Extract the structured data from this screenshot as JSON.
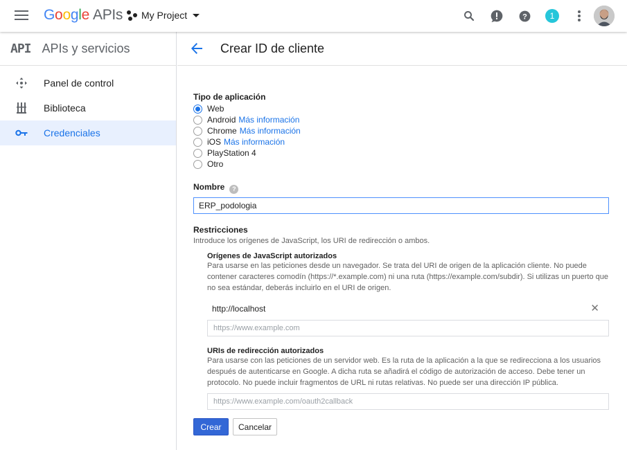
{
  "topbar": {
    "logo_google": [
      "G",
      "o",
      "o",
      "g",
      "l",
      "e"
    ],
    "logo_apis": "APIs",
    "project_name": "My Project",
    "notification_count": "1",
    "icons": [
      "menu-icon",
      "search-icon",
      "alert-icon",
      "help-icon",
      "more-vert-icon"
    ]
  },
  "sidebar": {
    "api_mark": "API",
    "title": "APIs y servicios",
    "items": [
      {
        "label": "Panel de control",
        "icon": "dashboard-icon"
      },
      {
        "label": "Biblioteca",
        "icon": "library-icon"
      },
      {
        "label": "Credenciales",
        "icon": "key-icon",
        "active": true
      }
    ]
  },
  "main": {
    "title": "Crear ID de cliente",
    "app_type": {
      "label": "Tipo de aplicación",
      "options": [
        {
          "label": "Web",
          "checked": true
        },
        {
          "label": "Android",
          "link": "Más información"
        },
        {
          "label": "Chrome",
          "link": "Más información"
        },
        {
          "label": "iOS",
          "link": "Más información"
        },
        {
          "label": "PlayStation 4"
        },
        {
          "label": "Otro"
        }
      ]
    },
    "name": {
      "label": "Nombre",
      "help": "?",
      "value": "ERP_podologia"
    },
    "restrictions": {
      "label": "Restricciones",
      "description": "Introduce los orígenes de JavaScript, los URI de redirección o ambos.",
      "js_origins": {
        "title": "Orígenes de JavaScript autorizados",
        "description": "Para usarse en las peticiones desde un navegador. Se trata del URI de origen de la aplicación cliente. No puede contener caracteres comodín (https://*.example.com) ni una ruta (https://example.com/subdir). Si utilizas un puerto que no sea estándar, deberás incluirlo en el URI de origen.",
        "entries": [
          "http://localhost"
        ],
        "placeholder": "https://www.example.com"
      },
      "redirect_uris": {
        "title": "URIs de redirección autorizados",
        "description": "Para usarse con las peticiones de un servidor web. Es la ruta de la aplicación a la que se redirecciona a los usuarios después de autenticarse en Google. A dicha ruta se añadirá el código de autorización de acceso. Debe tener un protocolo. No puede incluir fragmentos de URL ni rutas relativas. No puede ser una dirección IP pública.",
        "placeholder": "https://www.example.com/oauth2callback"
      }
    },
    "buttons": {
      "create": "Crear",
      "cancel": "Cancelar"
    }
  },
  "colors": {
    "accent": "#1a73e8",
    "primary_button": "#3367d6",
    "badge": "#26c6da"
  }
}
